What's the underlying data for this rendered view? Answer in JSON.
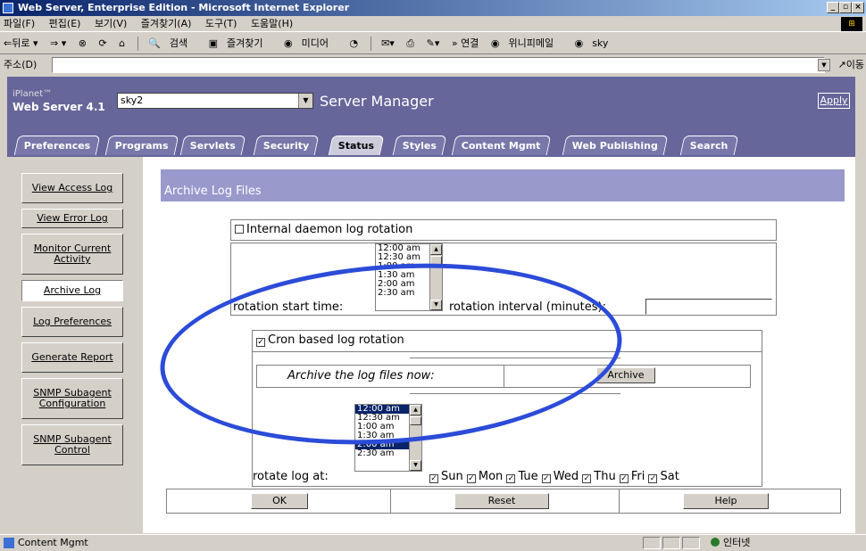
{
  "window": {
    "title": "Web Server, Enterprise Edition - Microsoft Internet Explorer"
  },
  "menu": [
    "파일(F)",
    "편집(E)",
    "보기(V)",
    "즐겨찾기(A)",
    "도구(T)",
    "도움말(H)"
  ],
  "toolbar": {
    "back": "⇐뒤로 ▾",
    "forward": "⇒ ▾",
    "search": "검색",
    "favorites": "즐겨찾기",
    "media": "미디어",
    "links_label": "» 연결",
    "link1": "위니피메일",
    "link2": "sky"
  },
  "address": {
    "label": "주소(D)",
    "value": "",
    "go": "이동"
  },
  "header": {
    "brand_top": "iPlanet™",
    "brand": "Web Server 4.1",
    "server_select": "sky2",
    "title": "Server Manager",
    "apply": "Apply"
  },
  "tabs": [
    {
      "label": "Preferences",
      "active": false
    },
    {
      "label": "Programs",
      "active": false
    },
    {
      "label": "Servlets",
      "active": false
    },
    {
      "label": "Security",
      "active": false
    },
    {
      "label": "Status",
      "active": true
    },
    {
      "label": "Styles",
      "active": false
    },
    {
      "label": "Content Mgmt",
      "active": false
    },
    {
      "label": "Web Publishing",
      "active": false
    },
    {
      "label": "Search",
      "active": false
    }
  ],
  "sidebar": [
    {
      "label": "View Access Log"
    },
    {
      "label": "View Error Log"
    },
    {
      "label": "Monitor Current Activity"
    },
    {
      "label": "Archive Log",
      "active": true
    },
    {
      "label": "Log Preferences"
    },
    {
      "label": "Generate Report"
    },
    {
      "label": "SNMP Subagent Configuration"
    },
    {
      "label": "SNMP Subagent Control"
    }
  ],
  "main": {
    "heading": "Archive Log Files",
    "internal": {
      "checkbox_label": "Internal daemon log rotation",
      "checked": false,
      "start_label": "rotation start time:",
      "interval_label": "rotation interval (minutes):",
      "interval_value": "",
      "times": [
        "12:00 am",
        "12:30 am",
        "1:00 am",
        "1:30 am",
        "2:00 am",
        "2:30 am"
      ]
    },
    "cron": {
      "checkbox_label": "Cron based log rotation",
      "checked": true,
      "archive_now_label": "Archive the log files now:",
      "archive_button": "Archive",
      "rotate_label": "rotate log at:",
      "times": [
        "12:00 am",
        "12:30 am",
        "1:00 am",
        "1:30 am",
        "2:00 am",
        "2:30 am"
      ],
      "selected_times": [
        "12:00 am",
        "2:00 am"
      ],
      "days": [
        {
          "label": "Sun",
          "checked": true
        },
        {
          "label": "Mon",
          "checked": true
        },
        {
          "label": "Tue",
          "checked": true
        },
        {
          "label": "Wed",
          "checked": true
        },
        {
          "label": "Thu",
          "checked": true
        },
        {
          "label": "Fri",
          "checked": true
        },
        {
          "label": "Sat",
          "checked": true
        }
      ]
    },
    "buttons": {
      "ok": "OK",
      "reset": "Reset",
      "help": "Help"
    }
  },
  "status": {
    "text": "Content Mgmt",
    "zone": "인터넷"
  },
  "colors": {
    "header": "#66669a",
    "section_bar": "#9999cc",
    "annotation": "#2b4bd8"
  }
}
